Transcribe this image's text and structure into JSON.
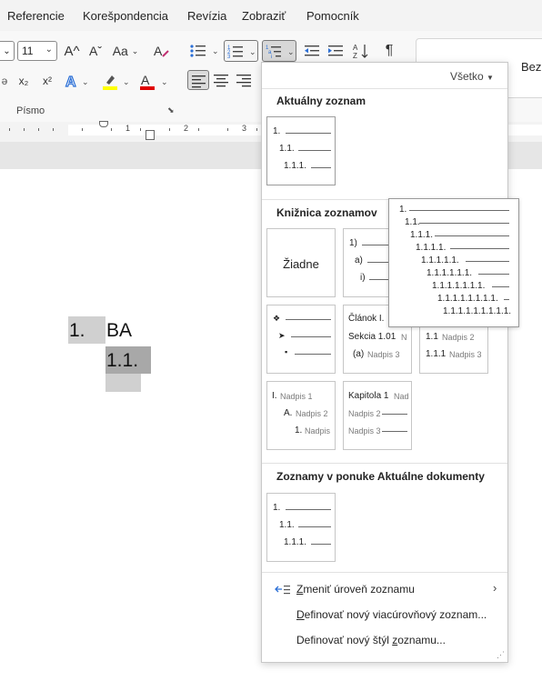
{
  "menubar": {
    "tabs": [
      "Referencie",
      "Korešpondencia",
      "Revízia",
      "Zobraziť",
      "Pomocník"
    ]
  },
  "ribbon": {
    "font_size": "11",
    "grow_font": "A^",
    "shrink_font": "Aˇ",
    "change_case": "Aa",
    "subscript": "x₂",
    "superscript": "x²",
    "font_group_label": "Písmo",
    "styles_partial": "Bez",
    "pilcrow": "¶"
  },
  "ruler": {
    "numbers": [
      "1",
      "2",
      "3"
    ]
  },
  "document": {
    "list_number_1": "1.",
    "list_text_1": "BA",
    "list_number_2": "1.1."
  },
  "dropdown": {
    "filter_label": "Všetko",
    "section_current": "Aktuálny zoznam",
    "section_library": "Knižnica zoznamov",
    "section_documents": "Zoznamy v ponuke Aktuálne dokumenty",
    "current_thumb": {
      "labels": [
        "1.",
        "1.1.",
        "1.1.1."
      ]
    },
    "library": {
      "none_label": "Žiadne",
      "paren_labels": [
        "1)",
        "a)",
        "i)"
      ],
      "article": {
        "labels": [
          "Článok I.",
          "Sekcia 1.01",
          "(a)"
        ],
        "gray": [
          "N",
          "N",
          "Nadpis 3"
        ]
      },
      "heading_numbered": {
        "labels": [
          "1.1",
          "1.1.1"
        ],
        "gray": [
          "Nadpis 2",
          "Nadpis 3"
        ]
      },
      "roman_heading": {
        "labels": [
          "I.",
          "A.",
          "1."
        ],
        "gray": [
          "Nadpis 1",
          "Nadpis 2",
          "Nadpis"
        ]
      },
      "chapter": {
        "labels": [
          "Kapitola 1",
          "Nadpis 2",
          "Nadpis 3"
        ],
        "gray": [
          "Nad"
        ]
      }
    },
    "documents_thumb": {
      "labels": [
        "1.",
        "1.1.",
        "1.1.1."
      ]
    },
    "items": [
      {
        "label": "Zmeniť úroveň zoznamu",
        "underline_char": "Z",
        "rest": "meniť úroveň zoznamu"
      },
      {
        "label": "Definovať nový viacúrovňový zoznam...",
        "underline_char": "D",
        "rest": "efinovať nový viacúrovňový zoznam..."
      },
      {
        "label": "Definovať nový štýl zoznamu...",
        "before": "Definovať nový štýl ",
        "underline_char": "z",
        "rest": "oznamu..."
      }
    ],
    "tooltip_levels": [
      "1.",
      "1.1.",
      "1.1.1.",
      "1.1.1.1.",
      "1.1.1.1.1.",
      "1.1.1.1.1.1.",
      "1.1.1.1.1.1.1.",
      "1.1.1.1.1.1.1.1.",
      "1.1.1.1.1.1.1.1.1."
    ]
  },
  "colors": {
    "highlight": "#ffff00",
    "font_color": "#e00000",
    "accent": "#2b579a"
  },
  "icons": [
    "bullets-icon",
    "numbering-icon",
    "multilevel-list-icon",
    "decrease-indent-icon",
    "increase-indent-icon",
    "sort-icon",
    "show-formatting-icon",
    "text-effects-icon",
    "highlight-icon",
    "font-color-icon",
    "align-left-icon",
    "align-center-icon",
    "align-right-icon",
    "clear-formatting-icon",
    "chevron-right-icon"
  ]
}
